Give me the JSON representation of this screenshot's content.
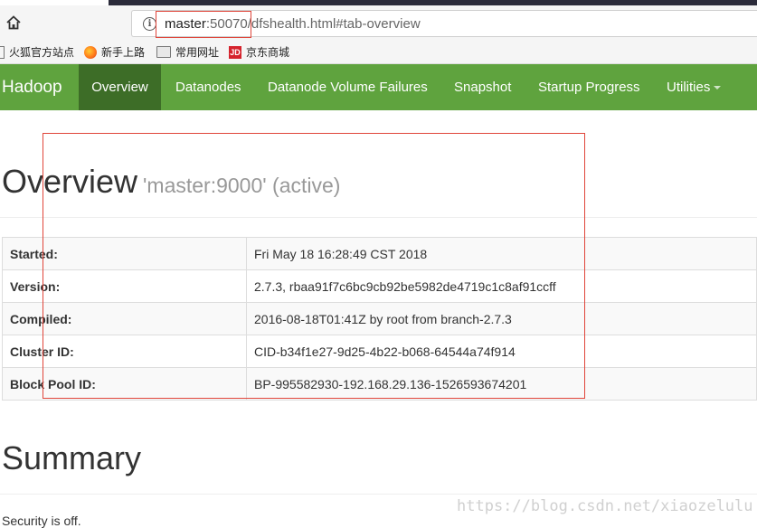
{
  "browser": {
    "url_host": "master",
    "url_rest": ":50070/dfshealth.html#tab-overview",
    "bookmarks": [
      {
        "label": "火狐官方站点",
        "icon": "firefox-page-icon"
      },
      {
        "label": "新手上路",
        "icon": "firefox-icon"
      },
      {
        "label": "常用网址",
        "icon": "folder-icon"
      },
      {
        "label": "京东商城",
        "icon": "jd-icon"
      }
    ]
  },
  "nav": {
    "brand": "Hadoop",
    "items": [
      {
        "label": "Overview",
        "active": true
      },
      {
        "label": "Datanodes"
      },
      {
        "label": "Datanode Volume Failures"
      },
      {
        "label": "Snapshot"
      },
      {
        "label": "Startup Progress"
      },
      {
        "label": "Utilities",
        "dropdown": true
      }
    ],
    "accent": "#5fa33e",
    "active_color": "#3d6d27"
  },
  "overview": {
    "title": "Overview",
    "subtitle": "'master:9000' (active)",
    "rows": [
      {
        "key": "Started:",
        "value": "Fri May 18 16:28:49 CST 2018"
      },
      {
        "key": "Version:",
        "value": "2.7.3, rbaa91f7c6bc9cb92be5982de4719c1c8af91ccff"
      },
      {
        "key": "Compiled:",
        "value": "2016-08-18T01:41Z by root from branch-2.7.3"
      },
      {
        "key": "Cluster ID:",
        "value": "CID-b34f1e27-9d25-4b22-b068-64544a74f914"
      },
      {
        "key": "Block Pool ID:",
        "value": "BP-995582930-192.168.29.136-1526593674201"
      }
    ]
  },
  "summary": {
    "title": "Summary",
    "security": "Security is off."
  },
  "watermark": "https://blog.csdn.net/xiaozelulu"
}
